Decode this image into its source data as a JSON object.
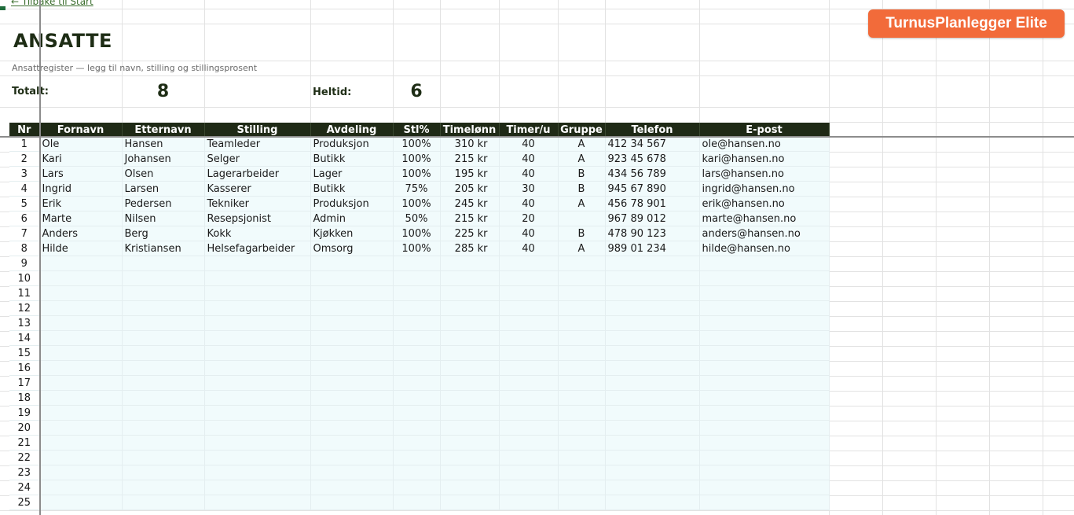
{
  "nav": {
    "back_label": "← Tilbake til Start"
  },
  "brand": {
    "label": "TurnusPlanlegger Elite",
    "color": "#f26b3a"
  },
  "header": {
    "title": "ANSATTE",
    "subtitle": "Ansattregister — legg til navn, stilling og stillingsprosent"
  },
  "stats": {
    "total_label": "Totalt:",
    "total_value": "8",
    "fulltime_label": "Heltid:",
    "fulltime_value": "6"
  },
  "table": {
    "columns": [
      "Nr",
      "Fornavn",
      "Etternavn",
      "Stilling",
      "Avdeling",
      "Stl%",
      "Timelønn",
      "Timer/u",
      "Gruppe",
      "Telefon",
      "E-post"
    ],
    "rows": [
      [
        "1",
        "Ole",
        "Hansen",
        "Teamleder",
        "Produksjon",
        "100%",
        "310 kr",
        "40",
        "A",
        "412 34 567",
        "ole@hansen.no"
      ],
      [
        "2",
        "Kari",
        "Johansen",
        "Selger",
        "Butikk",
        "100%",
        "215 kr",
        "40",
        "A",
        "923 45 678",
        "kari@hansen.no"
      ],
      [
        "3",
        "Lars",
        "Olsen",
        "Lagerarbeider",
        "Lager",
        "100%",
        "195 kr",
        "40",
        "B",
        "434 56 789",
        "lars@hansen.no"
      ],
      [
        "4",
        "Ingrid",
        "Larsen",
        "Kasserer",
        "Butikk",
        "75%",
        "205 kr",
        "30",
        "B",
        "945 67 890",
        "ingrid@hansen.no"
      ],
      [
        "5",
        "Erik",
        "Pedersen",
        "Tekniker",
        "Produksjon",
        "100%",
        "245 kr",
        "40",
        "A",
        "456 78 901",
        "erik@hansen.no"
      ],
      [
        "6",
        "Marte",
        "Nilsen",
        "Resepsjonist",
        "Admin",
        "50%",
        "215 kr",
        "20",
        "",
        "967 89 012",
        "marte@hansen.no"
      ],
      [
        "7",
        "Anders",
        "Berg",
        "Kokk",
        "Kjøkken",
        "100%",
        "225 kr",
        "40",
        "B",
        "478 90 123",
        "anders@hansen.no"
      ],
      [
        "8",
        "Hilde",
        "Kristiansen",
        "Helsefagarbeider",
        "Omsorg",
        "100%",
        "285 kr",
        "40",
        "A",
        "989 01 234",
        "hilde@hansen.no"
      ]
    ],
    "empty_rows": [
      "9",
      "10",
      "11",
      "12",
      "13",
      "14",
      "15",
      "16",
      "17",
      "18",
      "19",
      "20",
      "21",
      "22",
      "23",
      "24",
      "25"
    ]
  }
}
